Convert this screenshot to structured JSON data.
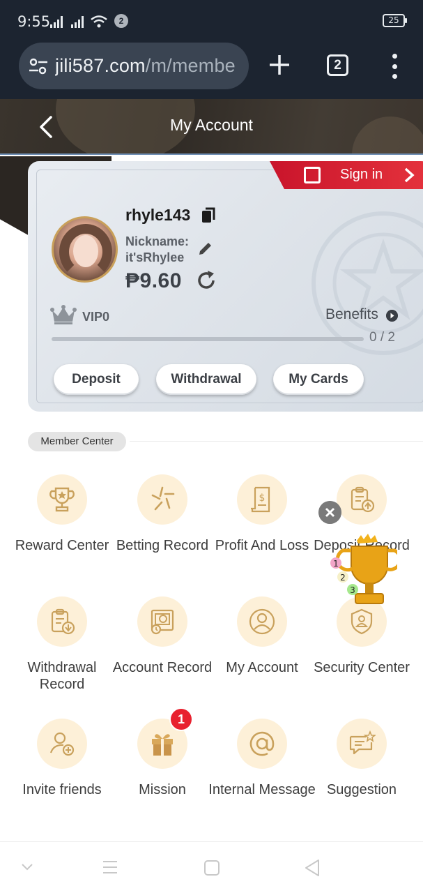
{
  "status_bar": {
    "time": "9:55",
    "notification_count": "2",
    "battery": "25"
  },
  "browser": {
    "url_host": "jili587.com",
    "url_path": "/m/membe",
    "tab_count": "2"
  },
  "header": {
    "title": "My Account"
  },
  "account": {
    "sign_in_label": "Sign in",
    "username": "rhyle143",
    "nickname_label": "Nickname:",
    "nickname": "it'sRhylee",
    "balance": "₱9.60",
    "vip_level": "VIP0",
    "benefits_label": "Benefits",
    "vip_progress": "0 / 2",
    "vip_progress_fraction": 0,
    "buttons": {
      "deposit": "Deposit",
      "withdrawal": "Withdrawal",
      "cards": "My Cards"
    }
  },
  "member_center": {
    "section_title": "Member Center",
    "items": [
      {
        "label": "Reward Center",
        "icon": "trophy-icon"
      },
      {
        "label": "Betting Record",
        "icon": "betting-record-icon"
      },
      {
        "label": "Profit And Loss",
        "icon": "profit-loss-icon"
      },
      {
        "label": "Deposit Record",
        "icon": "deposit-record-icon"
      },
      {
        "label": "Withdrawal Record",
        "icon": "withdrawal-record-icon"
      },
      {
        "label": "Account Record",
        "icon": "account-record-icon"
      },
      {
        "label": "My Account",
        "icon": "user-icon"
      },
      {
        "label": "Security Center",
        "icon": "shield-user-icon"
      },
      {
        "label": "Invite friends",
        "icon": "invite-user-icon"
      },
      {
        "label": "Mission",
        "icon": "gift-icon",
        "badge": "1"
      },
      {
        "label": "Internal Message",
        "icon": "at-sign-icon"
      },
      {
        "label": "Suggestion",
        "icon": "suggestion-icon"
      }
    ]
  },
  "floating_promo": {
    "ranks": [
      "1",
      "2",
      "3"
    ]
  },
  "colors": {
    "accent_red": "#e5333d",
    "icon_bg": "#fdf0d8",
    "icon_stroke": "#c9a15c",
    "header_bg": "#2f2a25"
  }
}
